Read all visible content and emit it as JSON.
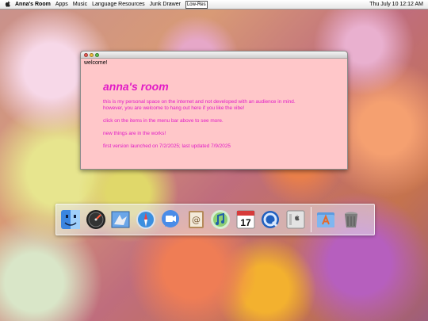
{
  "menubar": {
    "app_name": "Anna's Room",
    "items": [
      "Apps",
      "Music",
      "Language Resources",
      "Junk Drawer"
    ],
    "lowres_label": "Low-Res",
    "clock": "Thu July 10  12:12 AM"
  },
  "window": {
    "label": "welcome!",
    "heading": "anna's room",
    "line1": "this is my personal space on the internet and not developed with an audience in mind.",
    "line2": "however, you are welcome to hang out here if you like the vibe!",
    "line3": "click on the items in the menu bar above to see more.",
    "line4": "new things are in the works!",
    "line5": "first version launched on 7/2/2025; last updated 7/9/2025"
  },
  "dock": {
    "icons": [
      "finder-icon",
      "dashboard-icon",
      "mail-icon",
      "safari-icon",
      "ichat-icon",
      "address-book-icon",
      "itunes-icon",
      "ical-icon",
      "quicktime-icon",
      "system-preferences-icon",
      "applications-folder-icon",
      "trash-icon"
    ],
    "calendar_day": "17"
  },
  "colors": {
    "window_bg": "#ffc7c9",
    "accent_text": "#e21bc6"
  }
}
